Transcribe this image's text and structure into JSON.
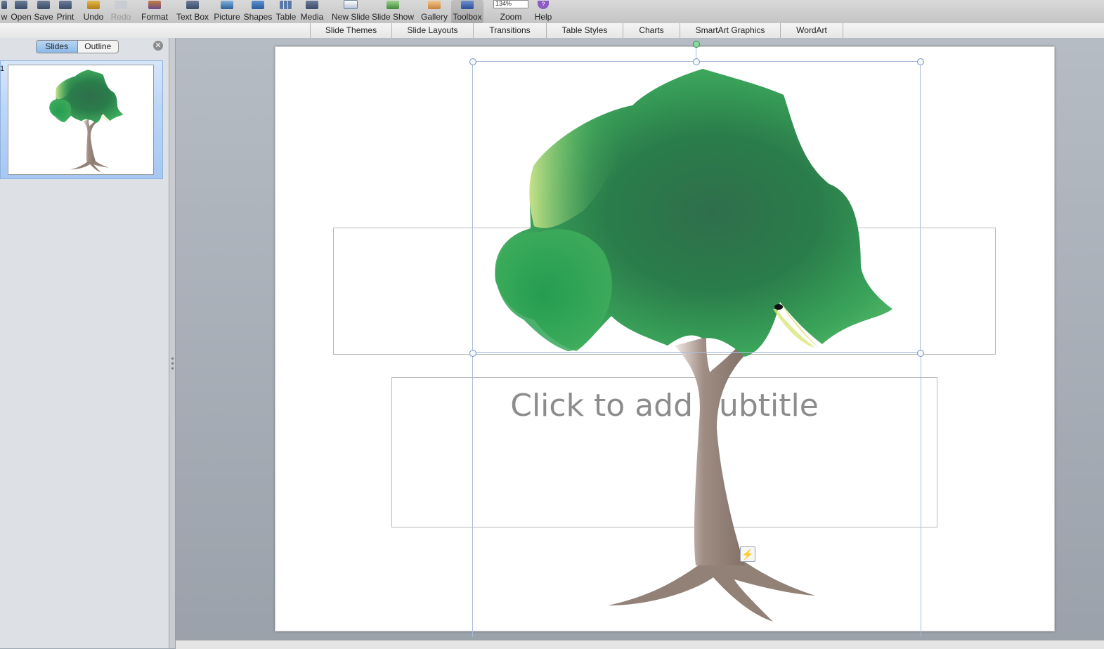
{
  "toolbar": {
    "buttons": [
      {
        "label": "w",
        "icon": "new-icon",
        "enabled": true
      },
      {
        "label": "Open",
        "icon": "open-icon",
        "enabled": true
      },
      {
        "label": "Save",
        "icon": "save-icon",
        "enabled": true
      },
      {
        "label": "Print",
        "icon": "print-icon",
        "enabled": true
      },
      {
        "label": "Undo",
        "icon": "undo-icon",
        "enabled": true
      },
      {
        "label": "Redo",
        "icon": "redo-icon",
        "enabled": false
      },
      {
        "label": "Format",
        "icon": "format-icon",
        "enabled": true
      },
      {
        "label": "Text Box",
        "icon": "text-box-icon",
        "enabled": true
      },
      {
        "label": "Picture",
        "icon": "picture-icon",
        "enabled": true
      },
      {
        "label": "Shapes",
        "icon": "shapes-icon",
        "enabled": true
      },
      {
        "label": "Table",
        "icon": "table-icon",
        "enabled": true
      },
      {
        "label": "Media",
        "icon": "media-icon",
        "enabled": true
      },
      {
        "label": "New Slide",
        "icon": "new-slide-icon",
        "enabled": true
      },
      {
        "label": "Slide Show",
        "icon": "slide-show-icon",
        "enabled": true
      },
      {
        "label": "Gallery",
        "icon": "gallery-icon",
        "enabled": true
      },
      {
        "label": "Toolbox",
        "icon": "toolbox-icon",
        "enabled": true
      }
    ],
    "zoom": {
      "label": "Zoom",
      "value": "134%"
    },
    "help": {
      "label": "Help",
      "glyph": "?"
    }
  },
  "ribbon": {
    "tabs": [
      "Slide Themes",
      "Slide Layouts",
      "Transitions",
      "Table Styles",
      "Charts",
      "SmartArt Graphics",
      "WordArt"
    ]
  },
  "sidebar": {
    "tabs": [
      "Slides",
      "Outline"
    ],
    "active_tab": "Slides",
    "close_glyph": "✕",
    "slide_number": "1"
  },
  "slide": {
    "subtitle_placeholder": "Click to add subtitle",
    "smart_tag_glyph": "⚡"
  },
  "colors": {
    "canopy_dark": "#2a7a4a",
    "canopy_light": "#4cb35e",
    "canopy_highlight": "#d8e67a",
    "trunk": "#8c7a70",
    "selection": "#7392c4"
  }
}
